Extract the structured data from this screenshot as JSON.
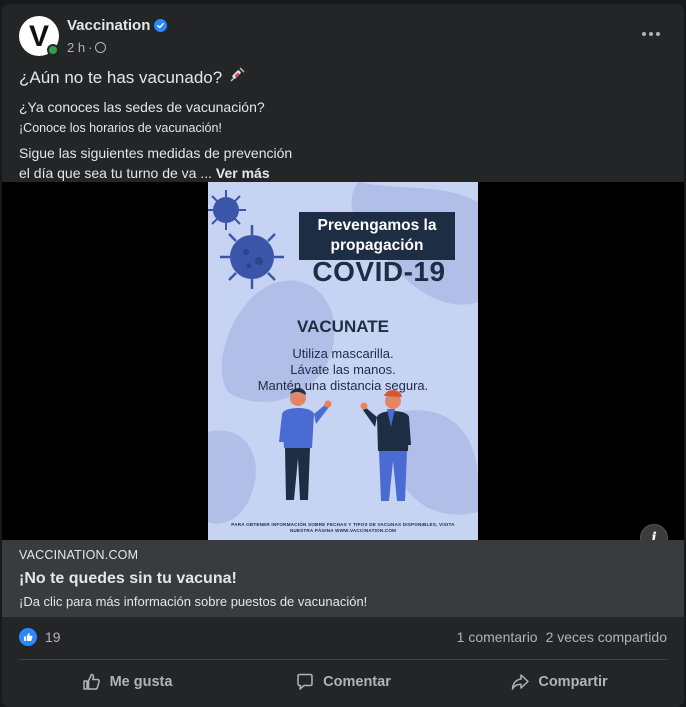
{
  "post": {
    "page_name": "Vaccination",
    "avatar_letter": "V",
    "time": "2 h",
    "meta_sep": "·",
    "text": {
      "line1": "¿Aún no te has vacunado?",
      "line2": "¿Ya conoces las sedes de vacunación?",
      "line3": "¡Conoce los horarios de vacunación!",
      "line4": "Sigue las siguientes medidas de prevención",
      "line5": "el día que sea tu turno de va ...",
      "see_more": "Ver más"
    },
    "icons": {
      "verified": "verified-badge-icon",
      "globe": "public-globe-icon",
      "more": "more-options-icon",
      "syringe": "syringe-emoji-icon",
      "info": "info-icon"
    }
  },
  "poster": {
    "title": "Prevengamos la propagación",
    "covid": "COVID-19",
    "vacunate": "VACUNATE",
    "tip1": "Utiliza mascarilla.",
    "tip2": "Lávate las manos.",
    "tip3": "Mantén una distancia segura.",
    "footer1": "PARA OBTENER INFORMACIÓN SOBRE FECHAS Y TIPOS DE VACUNAS DISPONIBLES, VISITA",
    "footer2": "NUESTRA PÁGINA WWW.VACCINATION.COM",
    "colors": {
      "background": "#c7d3f3",
      "dark": "#1d2d44",
      "virus": "#3b55a8"
    }
  },
  "link": {
    "domain": "VACCINATION.COM",
    "title": "¡No te quedes sin tu vacuna!",
    "description": "¡Da clic para más información sobre puestos de vacunación!"
  },
  "stats": {
    "likes": "19",
    "comments": "1 comentario",
    "shares": "2 veces compartido"
  },
  "actions": {
    "like": "Me gusta",
    "comment": "Comentar",
    "share": "Compartir"
  },
  "colors": {
    "accent": "#2d88ff",
    "card": "#242526",
    "online": "#31a24c"
  }
}
